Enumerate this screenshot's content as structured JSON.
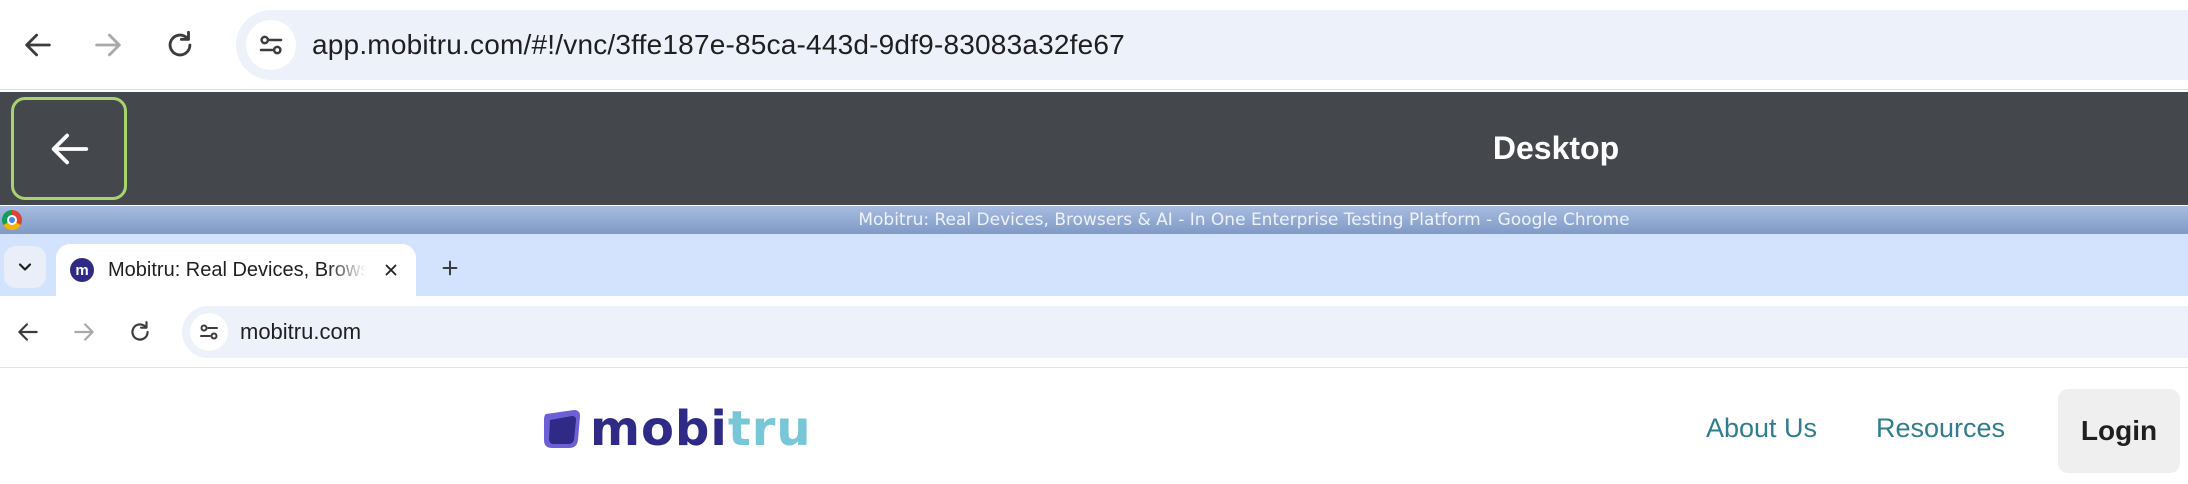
{
  "outer_browser": {
    "url": "app.mobitru.com/#!/vnc/3ffe187e-85ca-443d-9df9-83083a32fe67"
  },
  "vnc_header": {
    "title": "Desktop",
    "accent_color": "#a7d46f"
  },
  "remote_window": {
    "title": "Mobitru: Real Devices, Browsers & AI - In One Enterprise Testing Platform - Google Chrome",
    "tab": {
      "favicon_letter": "m",
      "title": "Mobitru: Real Devices, Browsers & AI - In One Enterprise Testing Platform"
    },
    "url": "mobitru.com"
  },
  "page": {
    "logo": {
      "part1": "mobi",
      "part2": "tru"
    },
    "nav": {
      "about": "About Us",
      "resources": "Resources"
    },
    "login": "Login",
    "colors": {
      "brand_dark": "#2e2a85",
      "brand_light": "#77c7d8",
      "link": "#2f7d8e"
    }
  }
}
